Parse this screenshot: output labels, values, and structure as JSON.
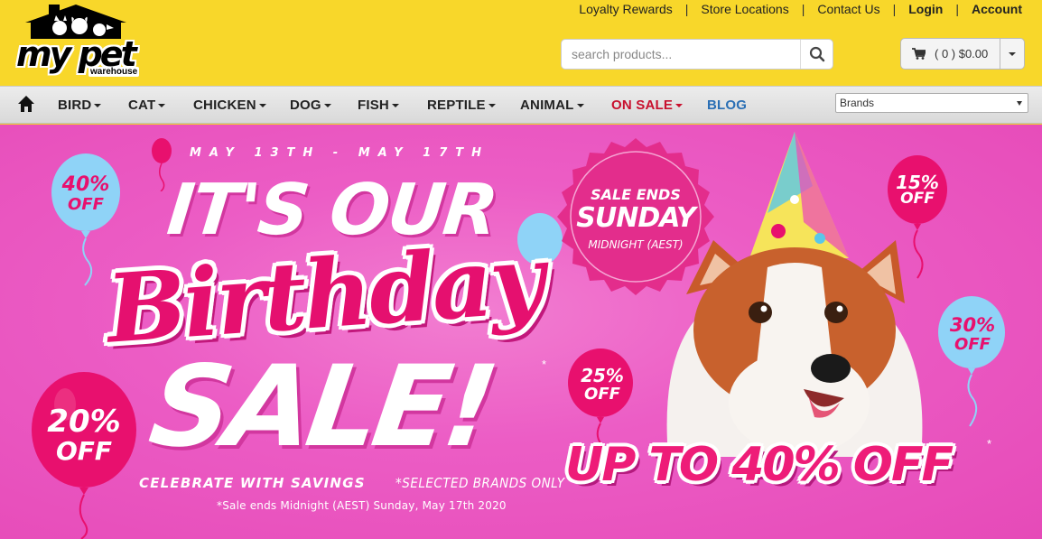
{
  "logo": {
    "main_text": "my pet",
    "sub_text": "warehouse"
  },
  "top_links": [
    {
      "label": "Loyalty Rewards",
      "bold": false
    },
    {
      "label": "Store Locations",
      "bold": false
    },
    {
      "label": "Contact Us",
      "bold": false
    },
    {
      "label": "Login",
      "bold": true
    },
    {
      "label": "Account",
      "bold": true
    }
  ],
  "search": {
    "placeholder": "search products...",
    "icon": "search-icon"
  },
  "cart": {
    "summary": "( 0 ) $0.00",
    "icon": "cart-icon"
  },
  "nav": {
    "home_icon": "home-icon",
    "items": [
      {
        "label": "BIRD"
      },
      {
        "label": "CAT"
      },
      {
        "label": "CHICKEN"
      },
      {
        "label": "DOG"
      },
      {
        "label": "FISH"
      },
      {
        "label": "REPTILE"
      },
      {
        "label": "ANIMAL"
      },
      {
        "label": "ON SALE"
      },
      {
        "label": "BLOG"
      }
    ],
    "brands_select": "Brands"
  },
  "banner": {
    "dates": "MAY 13TH - MAY 17TH",
    "headline_1": "IT'S OUR",
    "headline_2": "Birthday",
    "headline_3": "SALE!",
    "asterisk": "*",
    "celebrate": "CELEBRATE WITH SAVINGS",
    "selected_brands": "*SELECTED BRANDS ONLY",
    "fineprint": "*Sale ends Midnight (AEST) Sunday, May 17th 2020",
    "badge_line1": "SALE ENDS",
    "badge_line2": "SUNDAY",
    "badge_line3": "MIDNIGHT (AEST)",
    "up_to": "UP TO 40% OFF",
    "balloons": [
      {
        "pct": "40%",
        "off": "OFF",
        "color": "#8fd3f7"
      },
      {
        "pct": "15%",
        "off": "OFF",
        "color": "#e8106e"
      },
      {
        "pct": "30%",
        "off": "OFF",
        "color": "#8fd3f7"
      },
      {
        "pct": "25%",
        "off": "OFF",
        "color": "#e8106e"
      },
      {
        "pct": "20%",
        "off": "OFF",
        "color": "#e8106e"
      }
    ],
    "colors": {
      "pink_bg": "#ec5dc5",
      "hot_pink": "#e8106e",
      "light_blue": "#8fd3f7"
    }
  }
}
